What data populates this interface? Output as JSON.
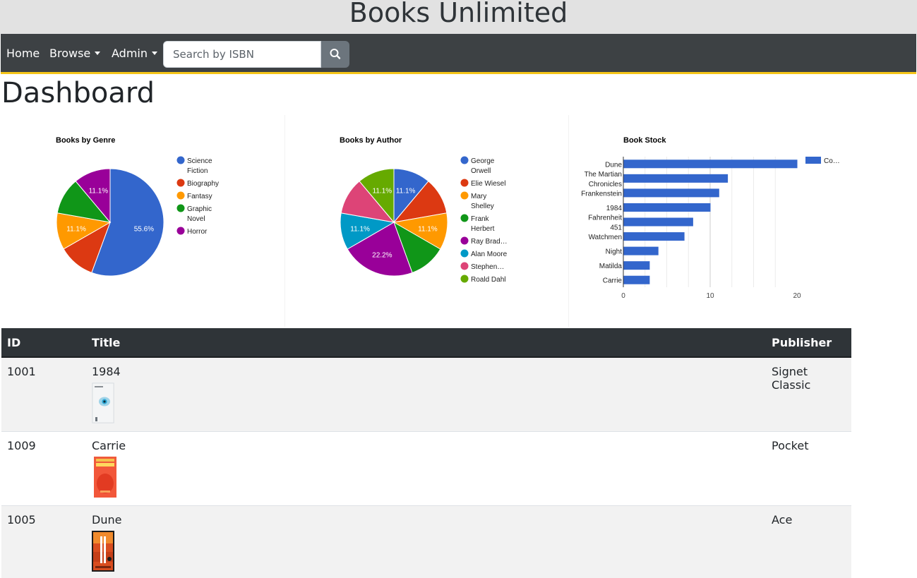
{
  "site": {
    "title": "Books Unlimited"
  },
  "nav": {
    "home": "Home",
    "browse": "Browse",
    "admin": "Admin",
    "search_placeholder": "Search by ISBN"
  },
  "page": {
    "title": "Dashboard"
  },
  "chart_data": [
    {
      "type": "pie",
      "title": "Books by Genre",
      "categories": [
        "Science Fiction",
        "Biography",
        "Fantasy",
        "Graphic Novel",
        "Horror"
      ],
      "values": [
        55.6,
        11.1,
        11.1,
        11.1,
        11.1
      ],
      "slice_labels": [
        "55.6%",
        "",
        "11.1%",
        "",
        "11.1%"
      ],
      "colors": [
        "#3366cc",
        "#dc3912",
        "#ff9900",
        "#109618",
        "#990099"
      ],
      "legend_lines": [
        [
          "Science",
          "Fiction"
        ],
        [
          "Biography"
        ],
        [
          "Fantasy"
        ],
        [
          "Graphic",
          "Novel"
        ],
        [
          "Horror"
        ]
      ],
      "legend_position": "right"
    },
    {
      "type": "pie",
      "title": "Books by Author",
      "categories": [
        "George Orwell",
        "Elie Wiesel",
        "Mary Shelley",
        "Frank Herbert",
        "Ray Bradbury",
        "Alan Moore",
        "Stephen King",
        "Roald Dahl"
      ],
      "values": [
        11.1,
        11.1,
        11.1,
        11.1,
        22.2,
        11.1,
        11.1,
        11.1
      ],
      "slice_labels": [
        "11.1%",
        "",
        "11.1%",
        "",
        "22.2%",
        "11.1%",
        "",
        "11.1%"
      ],
      "colors": [
        "#3366cc",
        "#dc3912",
        "#ff9900",
        "#109618",
        "#990099",
        "#0099c6",
        "#dd4477",
        "#66aa00"
      ],
      "legend_lines": [
        [
          "George",
          "Orwell"
        ],
        [
          "Elie Wiesel"
        ],
        [
          "Mary",
          "Shelley"
        ],
        [
          "Frank",
          "Herbert"
        ],
        [
          "Ray Brad…"
        ],
        [
          "Alan Moore"
        ],
        [
          "Stephen…"
        ],
        [
          "Roald Dahl"
        ]
      ],
      "legend_position": "right"
    },
    {
      "type": "bar",
      "orientation": "horizontal",
      "title": "Book Stock",
      "categories": [
        "Dune",
        "The Martian Chronicles",
        "Frankenstein",
        "1984",
        "Fahrenheit 451",
        "Watchmen",
        "Night",
        "Matilda",
        "Carrie"
      ],
      "category_lines": [
        [
          "Dune"
        ],
        [
          "The Martian",
          "Chronicles"
        ],
        [
          "Frankenstein"
        ],
        [
          "1984"
        ],
        [
          "Fahrenheit",
          "451"
        ],
        [
          "Watchmen"
        ],
        [
          "Night"
        ],
        [
          "Matilda"
        ],
        [
          "Carrie"
        ]
      ],
      "values": [
        20,
        12,
        11,
        10,
        8,
        7,
        4,
        3,
        3
      ],
      "series_legend": "Co…",
      "color": "#3366cc",
      "xlim": [
        0,
        20
      ],
      "xticks": [
        "0",
        "10",
        "20"
      ],
      "grid": true,
      "legend_position": "right"
    }
  ],
  "table": {
    "headers": [
      "ID",
      "Title",
      "Publisher"
    ],
    "rows": [
      {
        "id": "1001",
        "title": "1984",
        "publisher": "Signet Classic"
      },
      {
        "id": "1009",
        "title": "Carrie",
        "publisher": "Pocket"
      },
      {
        "id": "1005",
        "title": "Dune",
        "publisher": "Ace"
      }
    ]
  }
}
